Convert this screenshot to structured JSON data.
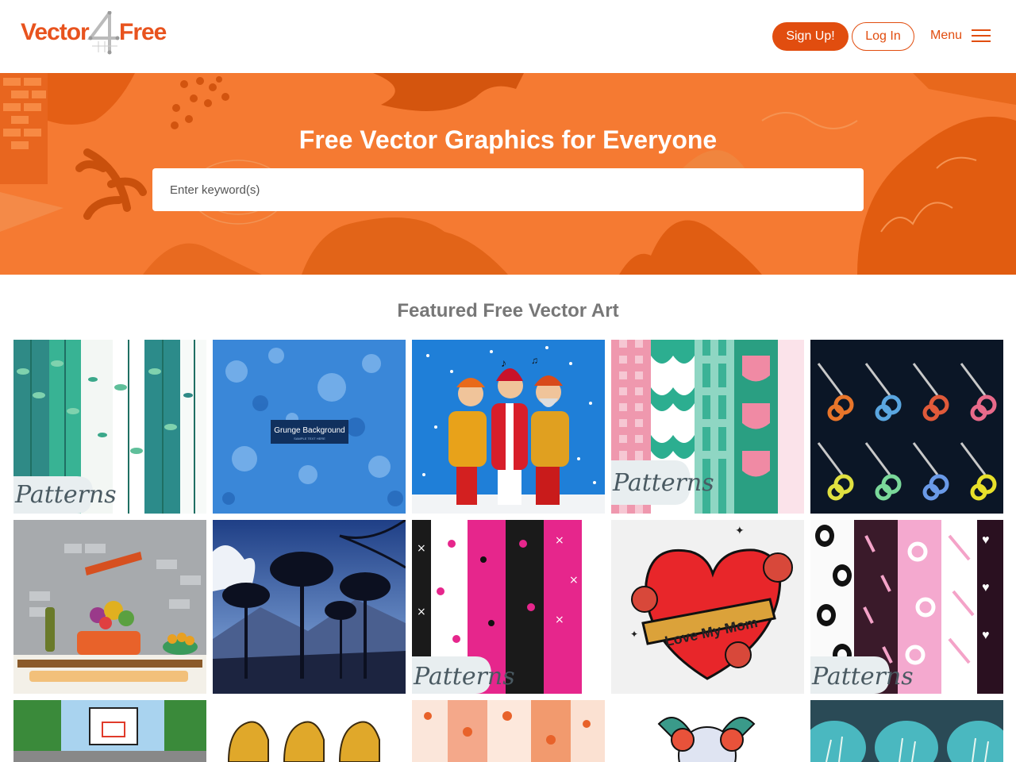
{
  "logo": {
    "left": "Vector",
    "right": "Free"
  },
  "header": {
    "signup_label": "Sign Up!",
    "login_label": "Log In",
    "menu_label": "Menu"
  },
  "hero": {
    "title": "Free Vector Graphics for Everyone",
    "search_placeholder": "Enter keyword(s)"
  },
  "featured": {
    "title": "Featured Free Vector Art",
    "grunge_label": "Grunge Background",
    "grunge_sub": "SAMPLE TEXT HERE",
    "patterns_label": "Patterns",
    "love_label": "Love My Mom"
  },
  "colors": {
    "brand": "#e14d0f",
    "hero_bg": "#f57a32"
  },
  "icons": [
    "hamburger-menu-icon"
  ]
}
